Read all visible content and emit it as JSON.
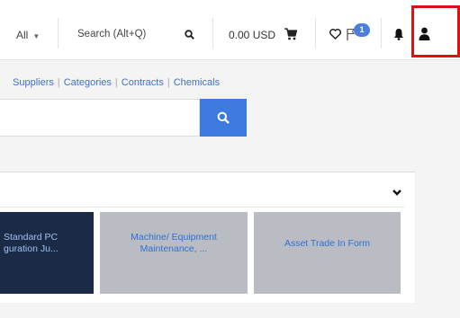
{
  "header": {
    "filter_label": "All",
    "search_placeholder": "Search (Alt+Q)",
    "cart_total": "0.00 USD",
    "notification_count": "1"
  },
  "nav": {
    "links": [
      "Suppliers",
      "Categories",
      "Contracts",
      "Chemicals"
    ],
    "separator": "|"
  },
  "tiles": [
    {
      "line1": "Standard PC",
      "line2": "guration Ju..."
    },
    {
      "line1": "Machine/ Equipment",
      "line2": "Maintenance, ..."
    },
    {
      "line1": "Asset Trade In Form",
      "line2": ""
    }
  ],
  "colors": {
    "accent": "#3d7ae0",
    "highlight": "#e01010",
    "tile_dark": "#1b2b45",
    "tile_gray": "#b9bdc3"
  },
  "icons": [
    "chevron-down-icon",
    "search-icon",
    "cart-icon",
    "heart-icon",
    "flag-icon",
    "bell-icon",
    "user-icon"
  ]
}
